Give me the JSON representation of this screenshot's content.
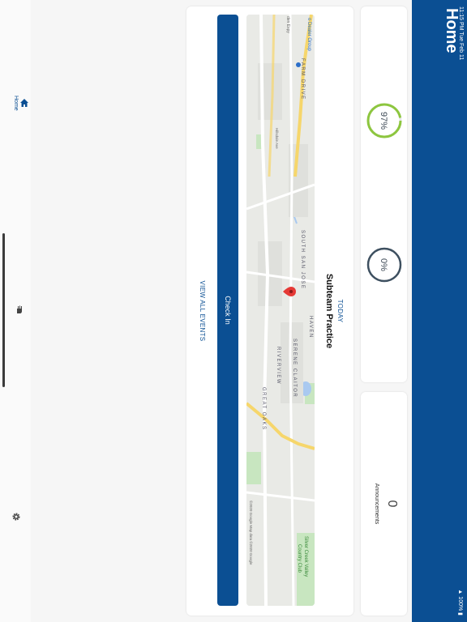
{
  "status_bar": {
    "time": "11:15 PM   Tue Feb 11",
    "battery": "▲ 100% ▮"
  },
  "header": {
    "title": "Home"
  },
  "sidebar": {
    "items": [
      {
        "label": "Home",
        "icon": "home-icon",
        "active": true
      },
      {
        "label": "",
        "icon": "hand-icon"
      },
      {
        "label": "",
        "icon": "gear-icon"
      }
    ]
  },
  "stats": {
    "rings": [
      {
        "percent": 97,
        "label": "97%",
        "color": "#8dc63f"
      },
      {
        "percent": 0,
        "label": "0%",
        "color": "#3e5060"
      }
    ]
  },
  "announcements": {
    "count": "0",
    "label": "Announcements"
  },
  "event": {
    "when": "TODAY",
    "title": "Subteam Practice",
    "checkin_label": "Check In",
    "view_all_label": "VIEW ALL EVENTS"
  },
  "map": {
    "labels": {
      "dealer": "o Dealer Group",
      "farm_drive": "FARM DRIVE",
      "expy": "den Expy",
      "south_san_jose": "SOUTH SAN JOSE",
      "haven": "HAVEN",
      "serene_claitor": "SERENE CLAITOR",
      "riverview": "RIVERVIEW",
      "great_oaks": "GREAT OAKS",
      "silver_creek": "Silver Creek Valley",
      "country_club": "Country Club",
      "hillsdale": "Hillsdale Ave",
      "copyright": "©2020 Google   Map data ©2020 Google"
    },
    "colors": {
      "road": "#ffffff",
      "highway": "#f6d66b",
      "park": "#c8e6c0",
      "water": "#a9c9f0"
    }
  },
  "colors": {
    "brand": "#0b4f93"
  }
}
